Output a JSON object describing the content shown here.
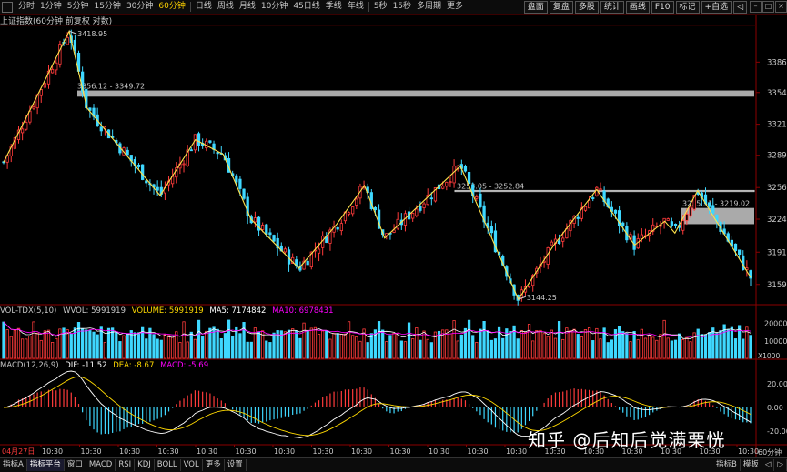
{
  "toolbar": {
    "tabs": [
      "分时",
      "1分钟",
      "5分钟",
      "15分钟",
      "30分钟",
      "60分钟",
      "日线",
      "周线",
      "月线",
      "10分钟",
      "45日线",
      "季线",
      "年线",
      "5秒",
      "15秒",
      "多周期",
      "更多"
    ],
    "active_tab": "60分钟",
    "right_buttons": [
      "盘面",
      "复盘",
      "多股",
      "统计",
      "画线",
      "F10",
      "标记",
      "+自选",
      "◁"
    ]
  },
  "title": "上证指数(60分钟 前复权 对数)",
  "price_axis": [
    "3386",
    "3354",
    "3321",
    "3289",
    "3256",
    "3224",
    "3191",
    "3159"
  ],
  "annotations": {
    "high": "3418.95",
    "low": "3144.25",
    "zone1": "3356.12 - 3349.72",
    "zone2": "3253.05 - 3252.84",
    "zone3": "3235.31 - 3219.02"
  },
  "volume": {
    "label": "VOL-TDX(5,10)",
    "wvol": "WVOL: 5991919",
    "volume": "VOLUME: 5991919",
    "ma5": "MA5: 7174842",
    "ma10": "MA10: 6978431",
    "axis": [
      "20000",
      "10000",
      "X1000"
    ]
  },
  "macd": {
    "label": "MACD(12,26,9)",
    "dif": "DIF: -11.52",
    "dea": "DEA: -8.67",
    "macd": "MACD: -5.69",
    "axis": [
      "20.00",
      "0.00",
      "-20.00"
    ]
  },
  "time_axis": {
    "date": "04月27日",
    "ticks": [
      "10:30",
      "10:30",
      "10:30",
      "10:30",
      "10:30",
      "10:30",
      "10:30",
      "10:30",
      "10:30",
      "10:30",
      "10:30",
      "10:30",
      "10:30",
      "10:30",
      "10:30",
      "10:30",
      "10:30",
      "10:30",
      "10:30"
    ],
    "right_label": "60分钟"
  },
  "bottom_tabs": [
    "指标A",
    "指标平台",
    "窗口",
    "MACD",
    "RSI",
    "KDJ",
    "BOLL",
    "VOL",
    "更多",
    "设置"
  ],
  "bottom_active": "指标平台",
  "bottom_right": [
    "指标B",
    "模板",
    "◁",
    "▷"
  ],
  "watermark": "知乎 @后知后觉满栗恍",
  "colors": {
    "up": "#ff3b3b",
    "down": "#3fd8ff",
    "zigzag": "#ffe24a",
    "dif": "#ffffff",
    "dea": "#ffd900",
    "ma5": "#ffffff",
    "ma10": "#ff00ff",
    "zone": "#c8c8c8"
  }
}
